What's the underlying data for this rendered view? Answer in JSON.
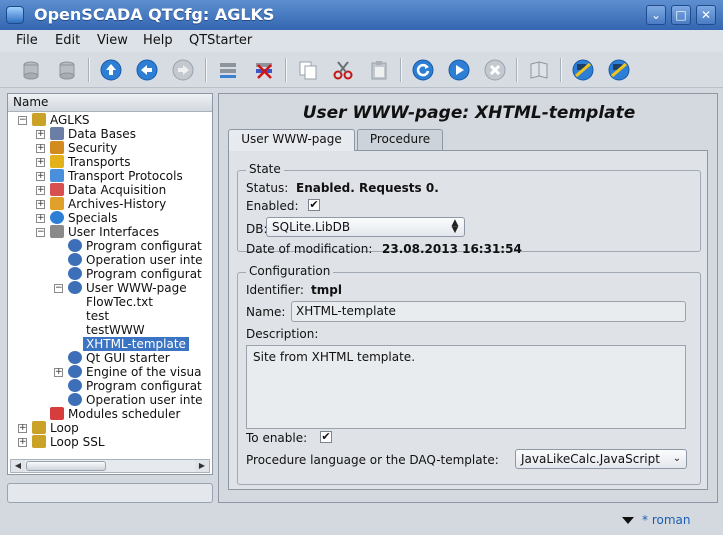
{
  "window": {
    "title": "OpenSCADA QTCfg: AGLKS",
    "buttons": [
      "⌄",
      "□",
      "✕"
    ]
  },
  "menu": [
    "File",
    "Edit",
    "View",
    "Help",
    "QTStarter"
  ],
  "toolbar_icons": [
    "db-load-icon",
    "db-save-icon",
    "up-icon",
    "back-icon",
    "forward-icon",
    "item-add-icon",
    "item-delete-icon",
    "copy-icon",
    "cut-icon",
    "paste-icon",
    "refresh-icon",
    "start-icon",
    "stop-icon",
    "manual-icon",
    "qtcfg-icon",
    "qtcfg2-icon"
  ],
  "tree": {
    "header": "Name",
    "items": [
      {
        "label": "AGLKS",
        "level": 0,
        "exp": "−",
        "icon": "folder"
      },
      {
        "label": "Data Bases",
        "level": 1,
        "exp": "+",
        "icon": "db"
      },
      {
        "label": "Security",
        "level": 1,
        "exp": "+",
        "icon": "security"
      },
      {
        "label": "Transports",
        "level": 1,
        "exp": "+",
        "icon": "transport"
      },
      {
        "label": "Transport Protocols",
        "level": 1,
        "exp": "+",
        "icon": "protocol"
      },
      {
        "label": "Data Acquisition",
        "level": 1,
        "exp": "+",
        "icon": "daq"
      },
      {
        "label": "Archives-History",
        "level": 1,
        "exp": "+",
        "icon": "archive"
      },
      {
        "label": "Specials",
        "level": 1,
        "exp": "+",
        "icon": "special"
      },
      {
        "label": "User Interfaces",
        "level": 1,
        "exp": "−",
        "icon": "ui"
      },
      {
        "label": "Program configurat",
        "level": 2,
        "exp": "",
        "icon": "module"
      },
      {
        "label": "Operation user inte",
        "level": 2,
        "exp": "",
        "icon": "module"
      },
      {
        "label": "Program configurat",
        "level": 2,
        "exp": "",
        "icon": "module"
      },
      {
        "label": "User WWW-page",
        "level": 2,
        "exp": "−",
        "icon": "module"
      },
      {
        "label": "FlowTec.txt",
        "level": 3,
        "exp": "",
        "icon": ""
      },
      {
        "label": "test",
        "level": 3,
        "exp": "",
        "icon": ""
      },
      {
        "label": "testWWW",
        "level": 3,
        "exp": "",
        "icon": ""
      },
      {
        "label": "XHTML-template",
        "level": 3,
        "exp": "",
        "icon": "",
        "selected": true
      },
      {
        "label": "Qt GUI starter",
        "level": 2,
        "exp": "",
        "icon": "module"
      },
      {
        "label": "Engine of the visua",
        "level": 2,
        "exp": "+",
        "icon": "module"
      },
      {
        "label": "Program configurat",
        "level": 2,
        "exp": "",
        "icon": "module"
      },
      {
        "label": "Operation user inte",
        "level": 2,
        "exp": "",
        "icon": "module"
      },
      {
        "label": "Modules scheduler",
        "level": 1,
        "exp": "",
        "icon": "sched"
      },
      {
        "label": "Loop",
        "level": 0,
        "exp": "+",
        "icon": "folder"
      },
      {
        "label": "Loop SSL",
        "level": 0,
        "exp": "+",
        "icon": "folder"
      }
    ]
  },
  "page": {
    "title": "User WWW-page: XHTML-template",
    "tabs": [
      "User WWW-page",
      "Procedure"
    ],
    "state": {
      "group_label": "State",
      "status_label": "Status:",
      "status_value": "Enabled. Requests 0.",
      "enabled_label": "Enabled:",
      "enabled_checked": true,
      "db_label": "DB:",
      "db_value": "SQLite.LibDB",
      "date_label": "Date of modification:",
      "date_value": "23.08.2013 16:31:54"
    },
    "config": {
      "group_label": "Configuration",
      "identifier_label": "Identifier:",
      "identifier_value": "tmpl",
      "name_label": "Name:",
      "name_value": "XHTML-template",
      "description_label": "Description:",
      "description_value": "Site from XHTML template.",
      "to_enable_label": "To enable:",
      "to_enable_checked": true,
      "proc_lang_label": "Procedure language or the DAQ-template:",
      "proc_lang_value": "JavaLikeCalc.JavaScript"
    }
  },
  "status": {
    "user": "* roman"
  }
}
